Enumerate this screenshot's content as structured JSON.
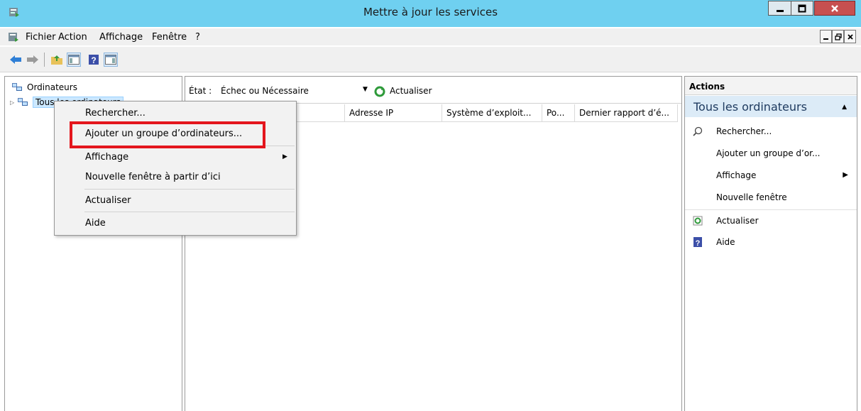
{
  "window": {
    "title": "Mettre à jour les services",
    "min_icon": "minimize-icon",
    "max_icon": "maximize-icon",
    "close_icon": "close-icon"
  },
  "menubar": {
    "items": [
      "Fichier",
      "Action",
      "Affichage",
      "Fenêtre",
      "?"
    ]
  },
  "toolbar": {
    "icons": [
      "back-arrow-icon",
      "forward-arrow-icon",
      "up-folder-icon",
      "show-hide-console-tree-icon",
      "help-icon",
      "show-hide-action-pane-icon"
    ]
  },
  "tree": {
    "root": "Ordinateurs",
    "child": "Tous les ordinateurs"
  },
  "filter": {
    "label": "État :",
    "value": "Échec ou Nécessaire",
    "refresh": "Actualiser"
  },
  "columns": [
    "",
    "Adresse IP",
    "Système d’exploit...",
    "Po...",
    "Dernier rapport d’é..."
  ],
  "context_menu": {
    "items": [
      {
        "label": "Rechercher..."
      },
      {
        "label": "Ajouter un groupe d’ordinateurs..."
      },
      {
        "label": "Affichage",
        "submenu": true
      },
      {
        "label": "Nouvelle fenêtre à partir d’ici"
      },
      {
        "label": "Actualiser"
      },
      {
        "label": "Aide"
      }
    ],
    "highlighted": "Ajouter un groupe d’ordinateurs...",
    "highlight_color": "#e4161d"
  },
  "actions": {
    "title": "Actions",
    "section": "Tous les ordinateurs",
    "items": [
      {
        "label": "Rechercher...",
        "icon": "search-icon"
      },
      {
        "label": "Ajouter un groupe d’or...",
        "icon": ""
      },
      {
        "label": "Affichage",
        "icon": "",
        "submenu": true
      },
      {
        "label": "Nouvelle fenêtre",
        "icon": ""
      },
      {
        "label": "Actualiser",
        "icon": "refresh-icon"
      },
      {
        "label": "Aide",
        "icon": "help-icon"
      }
    ]
  },
  "colors": {
    "title_bar": "#6fd0f0",
    "close_button": "#c75050",
    "actions_section": "#dcebf7",
    "selection": "#cce8ff"
  }
}
